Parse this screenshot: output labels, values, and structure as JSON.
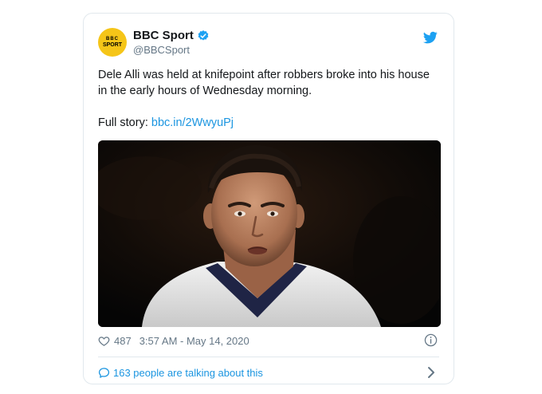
{
  "tweet": {
    "display_name": "BBC Sport",
    "handle": "@BBCSport",
    "avatar": {
      "line1": "BBC",
      "line2": "SPORT"
    },
    "text": "Dele Alli was held at knifepoint after robbers broke into his house in the early hours of Wednesday morning.",
    "full_story_label": "Full story:",
    "link": "bbc.in/2WwyuPj",
    "likes": "487",
    "timestamp": "3:57 AM - May 14, 2020",
    "talking": "163 people are talking about this"
  },
  "colors": {
    "accent": "#1b95e0",
    "avatar_bg": "#f5c518",
    "verified": "#1da1f2",
    "muted": "#657786"
  },
  "icons": [
    "verified-badge-icon",
    "twitter-bird-icon",
    "heart-icon",
    "info-icon",
    "speech-bubble-icon",
    "chevron-right-icon"
  ]
}
